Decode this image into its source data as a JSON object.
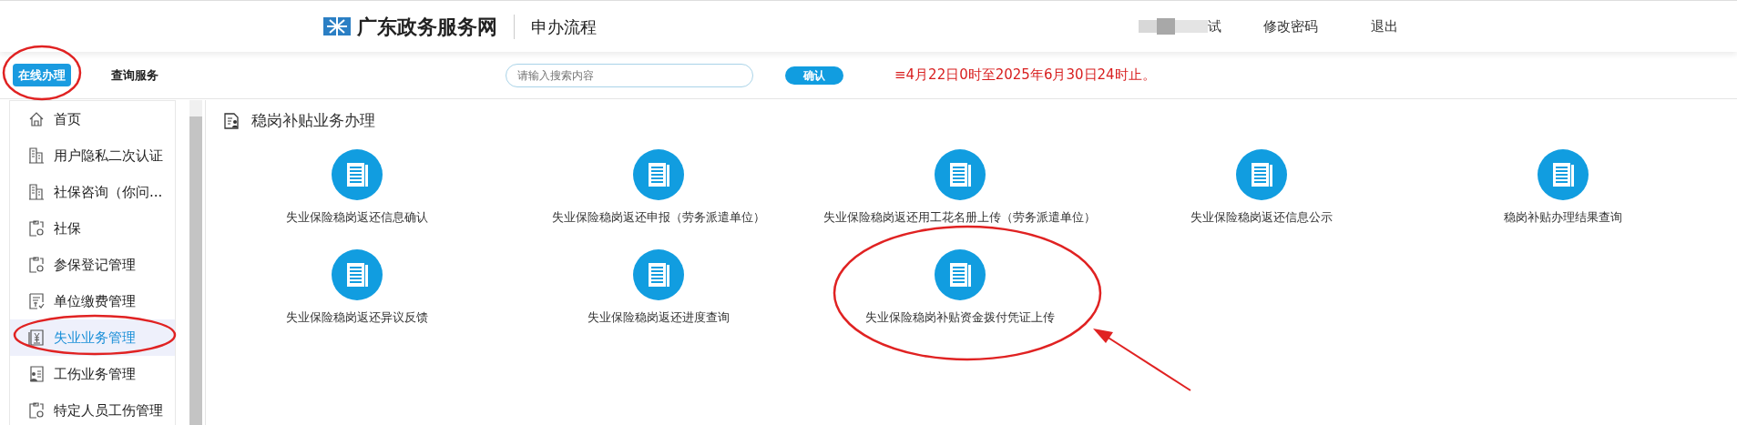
{
  "header": {
    "site_name": "广东政务服务网",
    "page_title": "申办流程",
    "user_name": "试",
    "links": [
      "修改密码",
      "退出"
    ]
  },
  "nav": {
    "tabs": [
      {
        "label": "在线办理",
        "selected": true
      },
      {
        "label": "查询服务",
        "selected": false
      }
    ],
    "search": {
      "placeholder": "请输入搜索内容"
    },
    "confirm_button": "确认",
    "notice": "≡4月22日0时至2025年6月30日24时止。"
  },
  "sidebar": {
    "items": [
      {
        "label": "首页",
        "kind": "home",
        "selected": false
      },
      {
        "label": "用户隐私二次认证",
        "kind": "building",
        "selected": false
      },
      {
        "label": "社保咨询（你问...",
        "kind": "building",
        "selected": false
      },
      {
        "label": "社保",
        "kind": "gear",
        "selected": false
      },
      {
        "label": "参保登记管理",
        "kind": "gear",
        "selected": false
      },
      {
        "label": "单位缴费管理",
        "kind": "bill",
        "selected": false
      },
      {
        "label": "失业业务管理",
        "kind": "yen",
        "selected": true
      },
      {
        "label": "工伤业务管理",
        "kind": "person",
        "selected": false
      },
      {
        "label": "特定人员工伤管理",
        "kind": "gear",
        "selected": false
      }
    ]
  },
  "content": {
    "title": "稳岗补贴业务办理",
    "services": [
      "失业保险稳岗返还信息确认",
      "失业保险稳岗返还申报（劳务派遣单位）",
      "失业保险稳岗返还用工花名册上传（劳务派遣单位）",
      "失业保险稳岗返还信息公示",
      "稳岗补贴办理结果查询",
      "失业保险稳岗返还异议反馈",
      "失业保险稳岗返还进度查询",
      "失业保险稳岗补贴资金拨付凭证上传"
    ]
  }
}
